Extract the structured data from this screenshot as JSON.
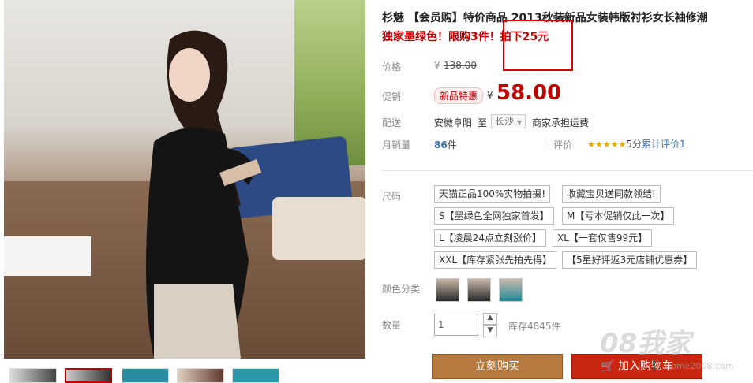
{
  "product": {
    "title": "杉魅 【会员购】特价商品 2013秋装新品女装韩版衬衫女长袖修潮",
    "promo_text": "独家墨绿色！限购3件！",
    "promo_highlight": "拍下25元"
  },
  "price": {
    "original_label": "价格",
    "currency": "¥",
    "original_value": "138.00",
    "promo_label": "促销",
    "promo_badge": "新品特惠",
    "promo_value": "58.00"
  },
  "shipping": {
    "label": "配送",
    "from": "安徽阜阳",
    "to_word": "至",
    "destination": "长沙",
    "note": "商家承担运费"
  },
  "sales": {
    "label": "月销量",
    "count": "86",
    "unit": "件",
    "review_label": "评价",
    "stars": "★★★★★",
    "rating_text": "5分",
    "review_count_text": "累计评价1"
  },
  "size": {
    "label": "尺码",
    "options": [
      "天猫正品100%实物拍摄!",
      "收藏宝贝送同款领结!",
      "S【墨绿色全网独家首发】",
      "M【亏本促销仅此一次】",
      "L【凌晨24点立刻涨价】",
      "XL【一套仅售99元】",
      "XXL【库存紧张先拍先得】",
      "【5星好评返3元店铺优惠券】"
    ]
  },
  "color": {
    "label": "颜色分类"
  },
  "quantity": {
    "label": "数量",
    "value": "1",
    "stock": "库存4845件"
  },
  "actions": {
    "buy_now": "立刻购买",
    "add_cart": "加入购物车"
  },
  "watermark": {
    "text": "08我家",
    "sub": "Home2008.com"
  },
  "colors": {
    "accent_red": "#c40000",
    "buy_button": "#b67a3f",
    "cart_button": "#c8260f"
  }
}
